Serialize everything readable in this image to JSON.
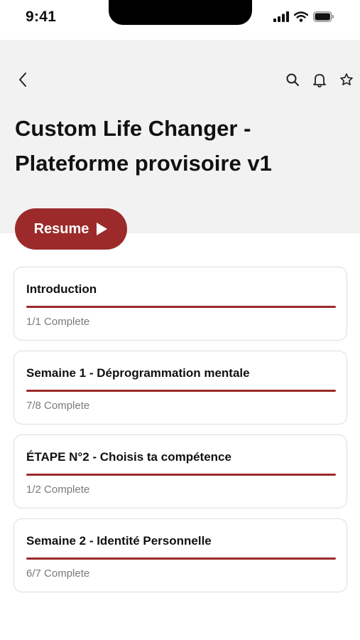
{
  "status_bar": {
    "time": "9:41",
    "icons": [
      "signal-icon",
      "wifi-icon",
      "battery-icon"
    ]
  },
  "header": {
    "icons": [
      "back-chevron-icon",
      "search-icon",
      "bell-icon",
      "star-icon"
    ],
    "title_line1": "Custom Life Changer -",
    "title_line2": "Plateforme provisoire v1"
  },
  "resume": {
    "label": "Resume",
    "icon": "play-icon"
  },
  "modules": [
    {
      "title": "Introduction",
      "status": "1/1 Complete",
      "progress": 1.0
    },
    {
      "title": "Semaine 1 - Déprogrammation mentale",
      "status": "7/8 Complete",
      "progress": 1.0
    },
    {
      "title": "ÉTAPE N°2 - Choisis ta compétence",
      "status": "1/2 Complete",
      "progress": 1.0
    },
    {
      "title": "Semaine 2 - Identité Personnelle",
      "status": "6/7 Complete",
      "progress": 1.0
    }
  ],
  "colors": {
    "accent": "#9c2a2a",
    "header_bg": "#f2f2f2",
    "muted_text": "#7a7a7a",
    "card_border": "#dedede"
  }
}
